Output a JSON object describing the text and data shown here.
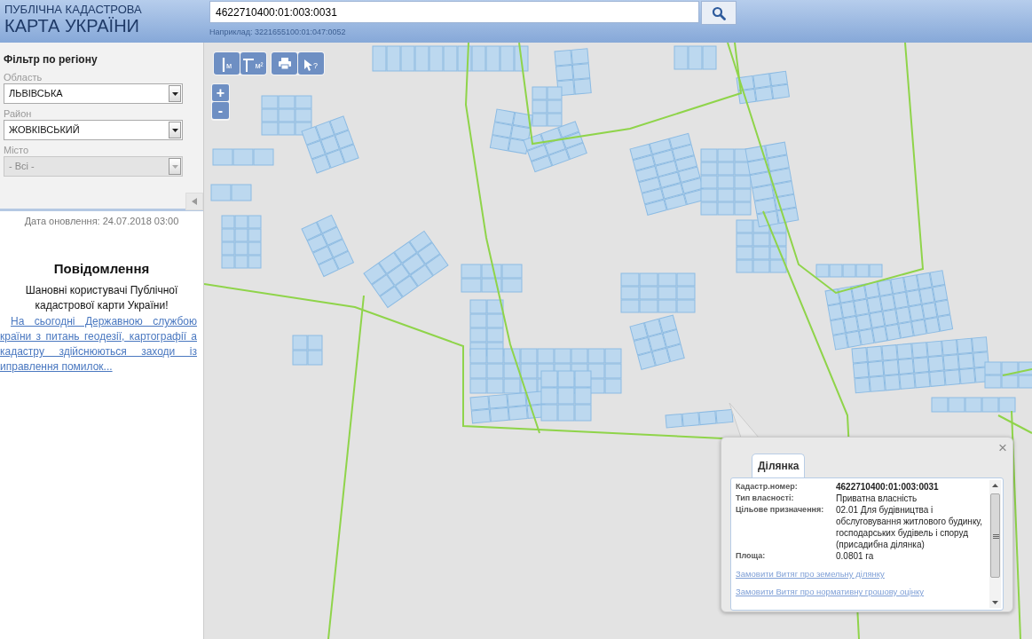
{
  "header": {
    "title_line1": "ПУБЛІЧНА КАДАСТРОВА",
    "title_line2": "КАРТА УКРАЇНИ",
    "search": {
      "value": "4622710400:01:003:0031"
    },
    "example": "Наприклад: 3221655100:01:047:0052"
  },
  "sidebar": {
    "filter_title": "Фільтр по регіону",
    "filters": [
      {
        "label": "Область",
        "value": "ЛЬВІВСЬКА",
        "disabled": false
      },
      {
        "label": "Район",
        "value": "ЖОВКІВСЬКИЙ",
        "disabled": false
      },
      {
        "label": "Місто",
        "value": "- Всі -",
        "disabled": true
      }
    ],
    "update_date": "Дата оновлення: 24.07.2018 03:00",
    "notice": {
      "title": "Повідомлення",
      "text": "Шановні користувачі Публічної кадастрової карти України!",
      "link": "На сьогодні Державною службою країни з питань геодезії, картографії а кадастру здійснюються заходи із иправлення помилок..."
    }
  },
  "map_tools": [
    [
      {
        "kind": "ruler",
        "label": "м"
      },
      {
        "kind": "area",
        "label": "м²"
      }
    ],
    [
      {
        "kind": "print"
      },
      {
        "kind": "identify",
        "label": "?"
      }
    ]
  ],
  "zoom": [
    "+",
    "-"
  ],
  "popup": {
    "close": "×",
    "tabs": [
      {
        "label": "Ділянка",
        "selected": true
      }
    ],
    "fields": [
      {
        "label": "Кадастр.номер:",
        "value": "4622710400:01:003:0031",
        "bold": true
      },
      {
        "label": "Тип власності:",
        "value": "Приватна власність",
        "bold": false
      },
      {
        "label": "Цільове призначення:",
        "value": "02.01 Для будівництва і обслуговування житлового будинку, господарських будівель і споруд (присадибна ділянка)",
        "bold": false
      },
      {
        "label": "Площа:",
        "value": "0.0801 га",
        "bold": false
      }
    ],
    "links": [
      "Замовити Витяг про земельну ділянку",
      "Замовити Витяг про нормативну грошову оцінку"
    ]
  }
}
